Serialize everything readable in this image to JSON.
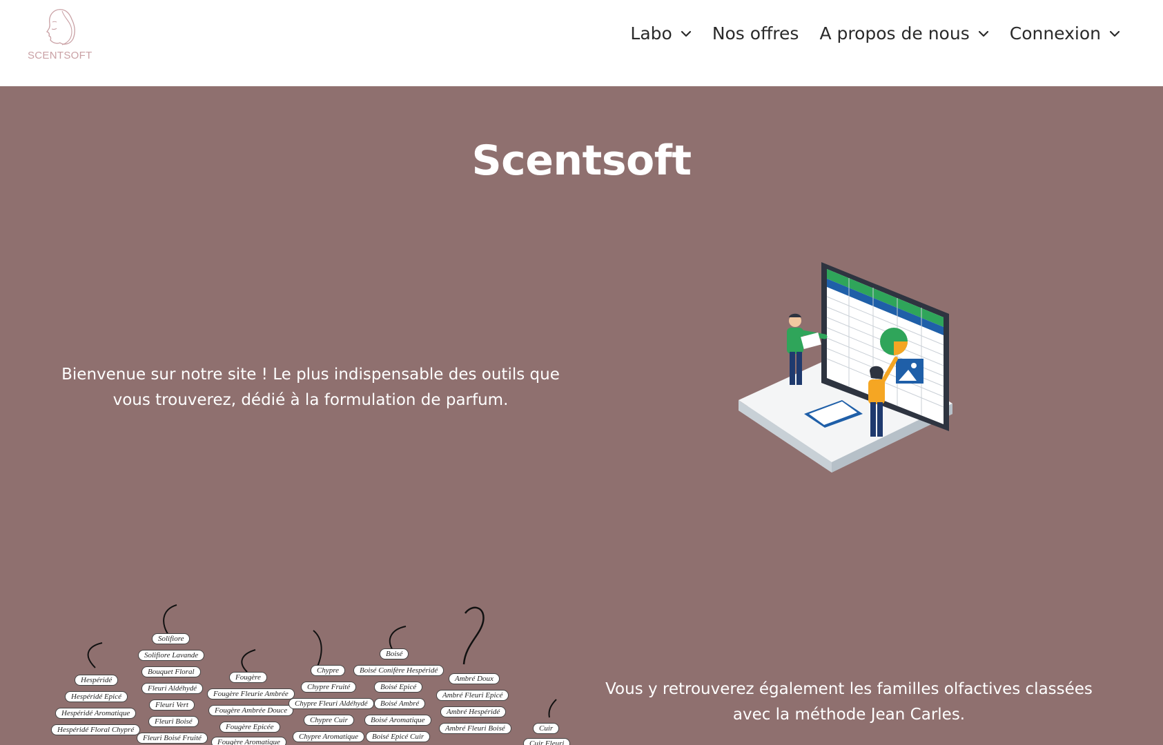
{
  "brand": {
    "name": "SCENTSOFT",
    "accent": "#c9a0a4"
  },
  "nav": {
    "items": [
      {
        "label": "Labo",
        "dropdown": true
      },
      {
        "label": "Nos offres",
        "dropdown": false
      },
      {
        "label": "A propos de nous",
        "dropdown": true
      },
      {
        "label": "Connexion",
        "dropdown": true
      }
    ]
  },
  "hero": {
    "title": "Scentsoft"
  },
  "intro": {
    "text": "Bienvenue sur notre site ! Le plus indispensable des outils que vous trouverez, dédié à la formulation de parfum."
  },
  "families_image": {
    "labels": [
      "Hespéridé",
      "Hespéridé Epicé",
      "Hespéridé Aromatique",
      "Hespéridé Floral Chypré",
      "Solifiore",
      "Solifiore Lavande",
      "Bouquet Floral",
      "Fleuri Aldéhydé",
      "Fleuri Vert",
      "Fleuri Boisé",
      "Fleuri Boisé Fruité",
      "Fougère",
      "Fougère Fleurie Ambrée",
      "Fougère Ambrée Douce",
      "Fougère Epicée",
      "Fougère Aromatique",
      "Chypre",
      "Chypre Fruité",
      "Chypre Fleuri Aldéhydé",
      "Chypre Cuir",
      "Chypre Aromatique",
      "Boisé",
      "Boisé Conifère Hespéridé",
      "Boisé Epicé",
      "Boisé Ambré",
      "Boisé Aromatique",
      "Boisé Epicé Cuir",
      "Ambré Doux",
      "Ambré Fleuri Epicé",
      "Ambré Hespéridé",
      "Ambré Fleuri Boisé",
      "Cuir",
      "Cuir Fleuri"
    ]
  },
  "second": {
    "text": "Vous y retrouverez également les familles olfactives classées avec la méthode Jean Carles."
  },
  "colors": {
    "background": "#8f706f",
    "header": "#ffffff",
    "nav_text": "#2a2a2a"
  }
}
